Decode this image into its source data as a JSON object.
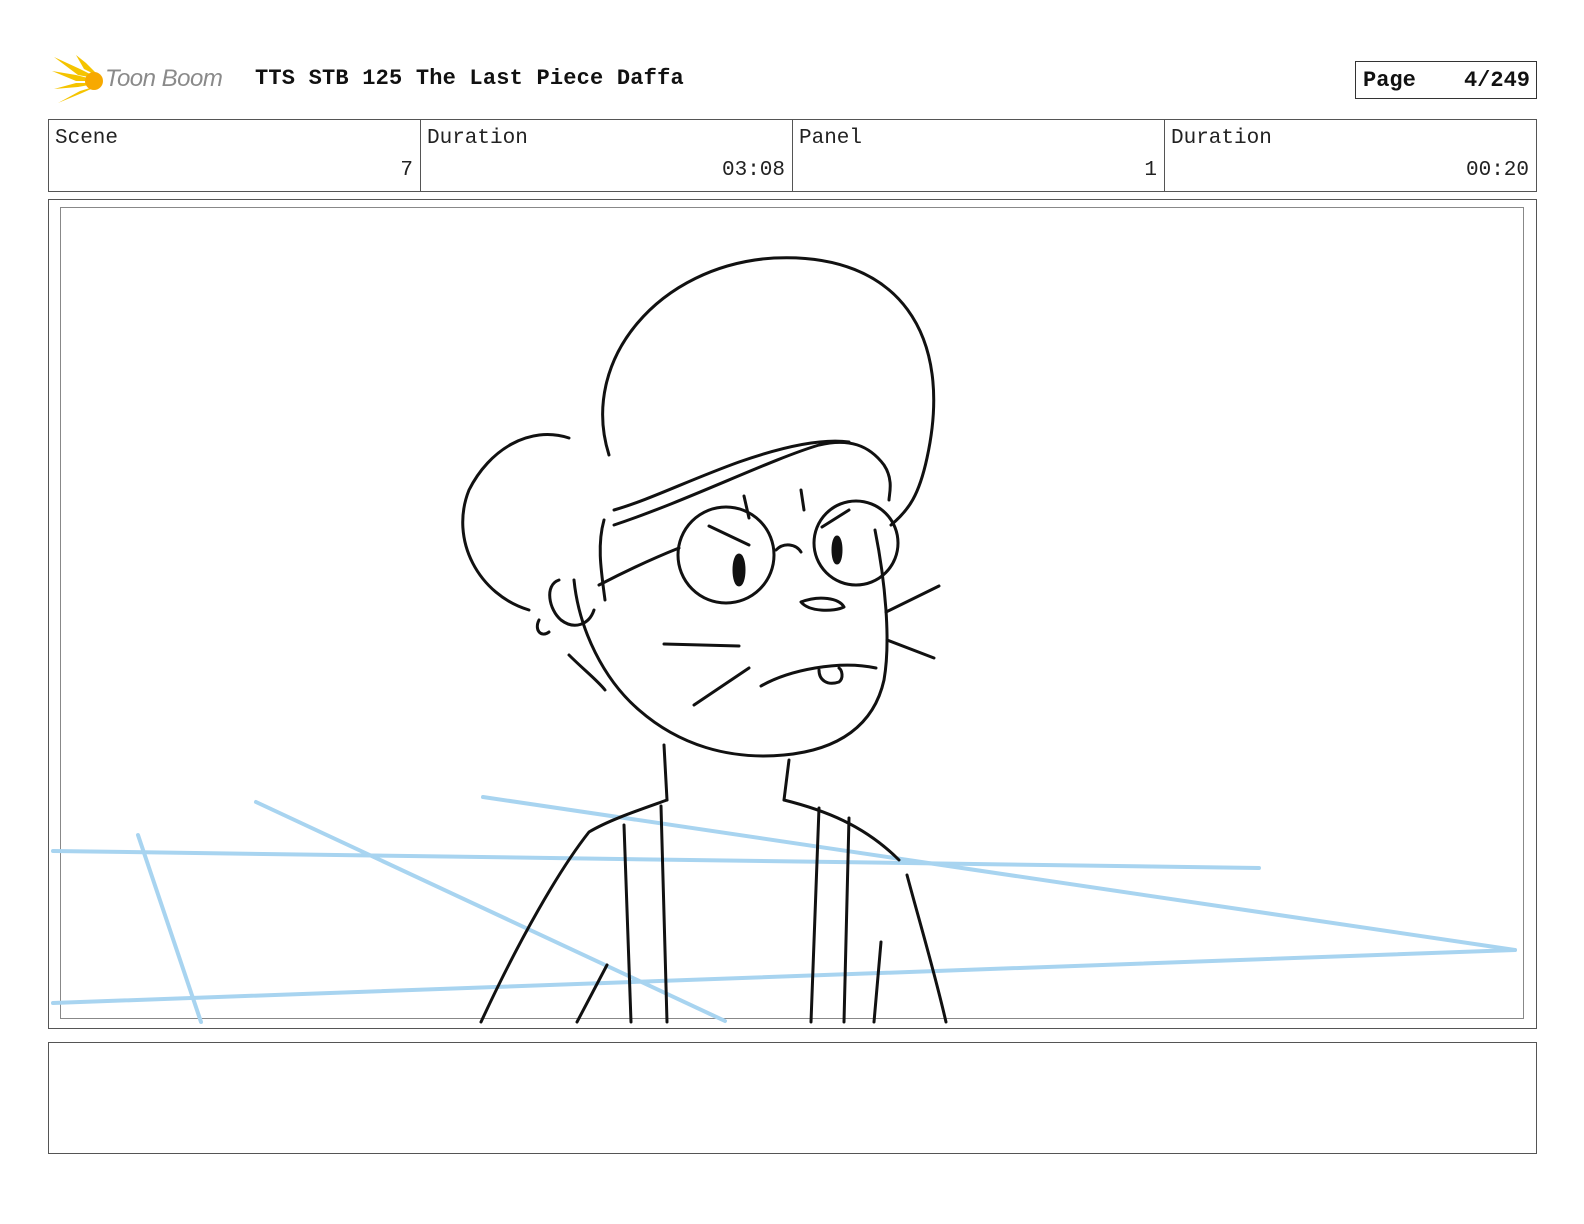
{
  "header": {
    "logo_text": "Toon Boom",
    "doc_title": "TTS STB 125 The Last Piece Daffa",
    "page_label": "Page",
    "page_value": "4/249"
  },
  "info": {
    "scene_label": "Scene",
    "scene_value": "7",
    "scene_duration_label": "Duration",
    "scene_duration_value": "03:08",
    "panel_label": "Panel",
    "panel_value": "1",
    "panel_duration_label": "Duration",
    "panel_duration_value": "00:20"
  },
  "colors": {
    "logo_accent": "#f5c400",
    "sketch_ink": "#111111",
    "guide_lines": "#a8d4f0"
  },
  "notes": {
    "text": ""
  }
}
